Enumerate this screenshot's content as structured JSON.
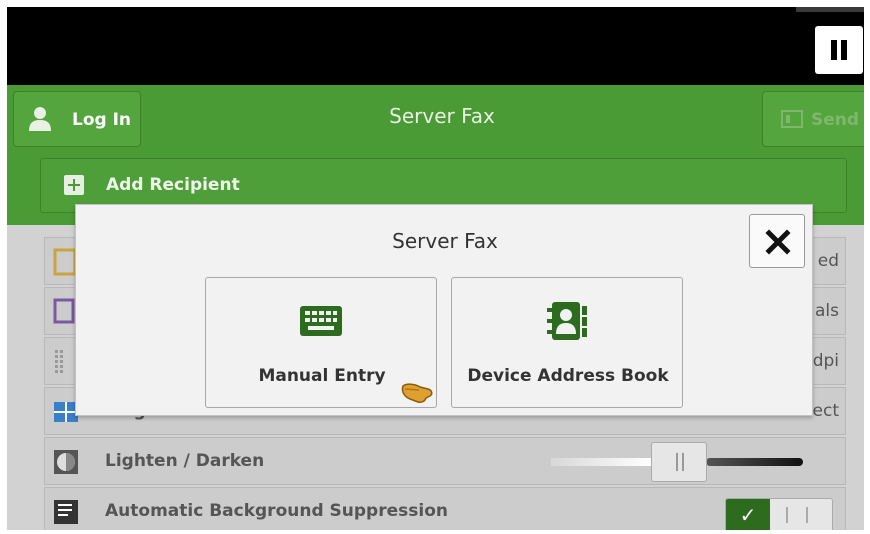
{
  "header": {
    "login_label": "Log In",
    "title": "Server Fax",
    "send_label": "Send",
    "add_recipient_label": "Add Recipient"
  },
  "settings": {
    "rows": [
      {
        "label": "",
        "value": "ed"
      },
      {
        "label": "",
        "value": "als"
      },
      {
        "label": "",
        "value": "dpi"
      },
      {
        "label": "Original Size",
        "value": "Auto Detect"
      },
      {
        "label": "Lighten / Darken",
        "value": ""
      },
      {
        "label": "Automatic Background Suppression",
        "value": ""
      }
    ],
    "lighten_darken_level_fraction": 0.5,
    "background_suppression_on": true
  },
  "dialog": {
    "title": "Server Fax",
    "options": [
      {
        "label": "Manual Entry",
        "icon": "keyboard-icon"
      },
      {
        "label": "Device Address Book",
        "icon": "address-book-icon"
      }
    ],
    "close_icon": "close-icon"
  },
  "colors": {
    "header_green": "#4a9a35",
    "dialog_icon_green": "#2d6b1e",
    "top_bar": "#000000"
  }
}
